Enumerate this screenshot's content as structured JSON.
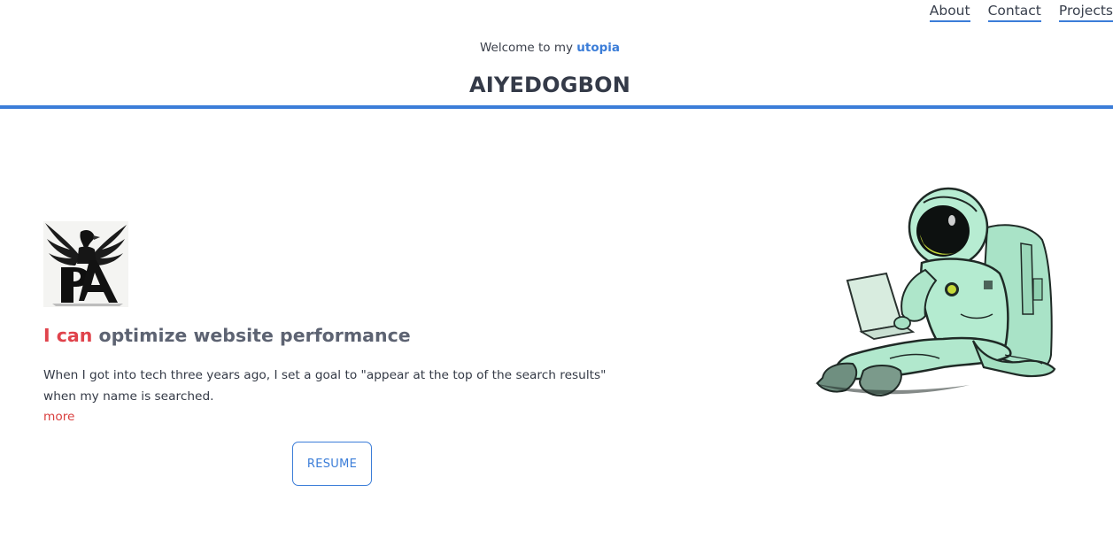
{
  "nav": {
    "items": [
      {
        "label": "About"
      },
      {
        "label": "Contact"
      },
      {
        "label": "Projects"
      }
    ]
  },
  "header": {
    "welcome_prefix": "Welcome to my ",
    "welcome_highlight": "utopia",
    "site_title": "AIYEDOGBON"
  },
  "hero": {
    "headline_accent": "I can",
    "headline_rest": " optimize website performance",
    "intro": "When I got into tech three years ago, I set a goal to \"appear at the top of the search results\" when my name is searched.",
    "more_label": "more",
    "resume_label": "RESUME"
  },
  "colors": {
    "accent_blue": "#3b7dd8",
    "accent_red": "#e0434c",
    "astronaut_suit": "#b7ecd2"
  },
  "icons": {
    "logo": "eagle-monogram-logo",
    "illustration": "astronaut-with-laptop"
  }
}
